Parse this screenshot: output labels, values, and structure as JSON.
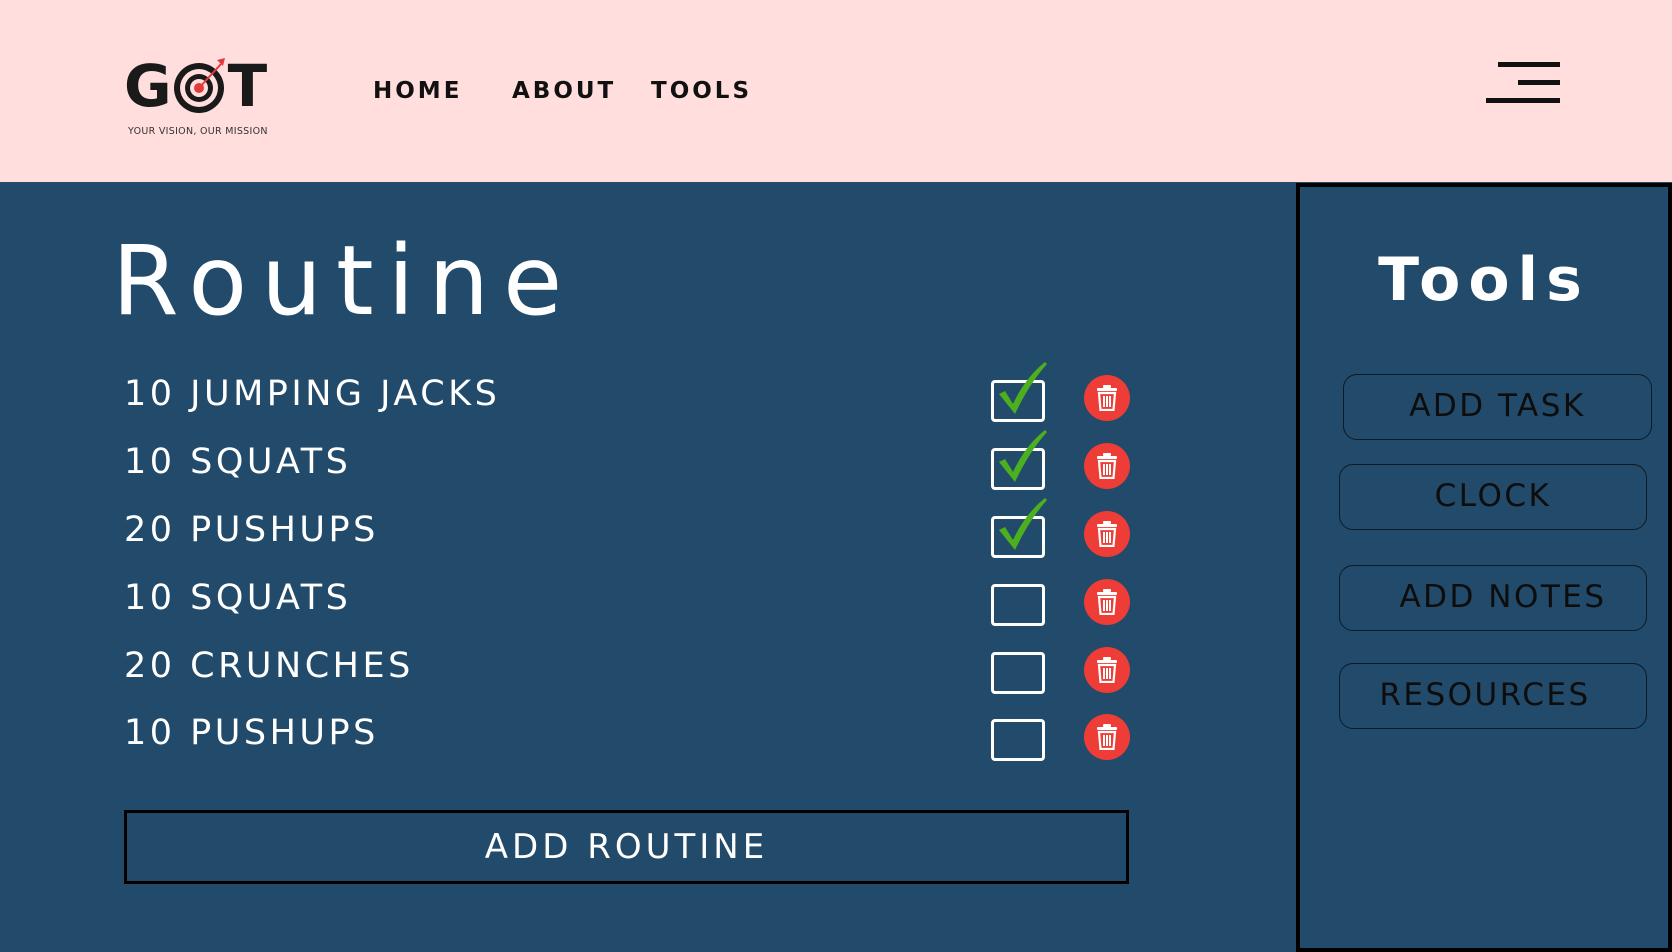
{
  "header": {
    "logo": {
      "wordmark_left": "G",
      "wordmark_right": "T",
      "tagline": "YOUR VISION, OUR MISSION"
    },
    "nav": {
      "home": "HOME",
      "about": "ABOUT",
      "tools": "TOOLS"
    },
    "menu_icon": "hamburger-menu-icon"
  },
  "main": {
    "title": "Routine",
    "routines": [
      {
        "label": "10 JUMPING JACKS",
        "checked": true
      },
      {
        "label": "10 SQUATS",
        "checked": true
      },
      {
        "label": "20 PUSHUPS",
        "checked": true
      },
      {
        "label": "10 SQUATS",
        "checked": false
      },
      {
        "label": "20 CRUNCHES",
        "checked": false
      },
      {
        "label": "10 PUSHUPS",
        "checked": false
      }
    ],
    "add_routine_label": "ADD ROUTINE",
    "delete_icon": "trash-icon"
  },
  "sidebar": {
    "title": "Tools",
    "buttons": {
      "add_task": "ADD TASK",
      "clock": "CLOCK",
      "add_notes": "ADD NOTES",
      "resources": "RESOURCES"
    }
  },
  "colors": {
    "header_bg": "#ffdedd",
    "main_bg": "#224a6a",
    "delete": "#ee3d36",
    "check": "#4caf1f",
    "logo_accent": "#e23b3b"
  }
}
